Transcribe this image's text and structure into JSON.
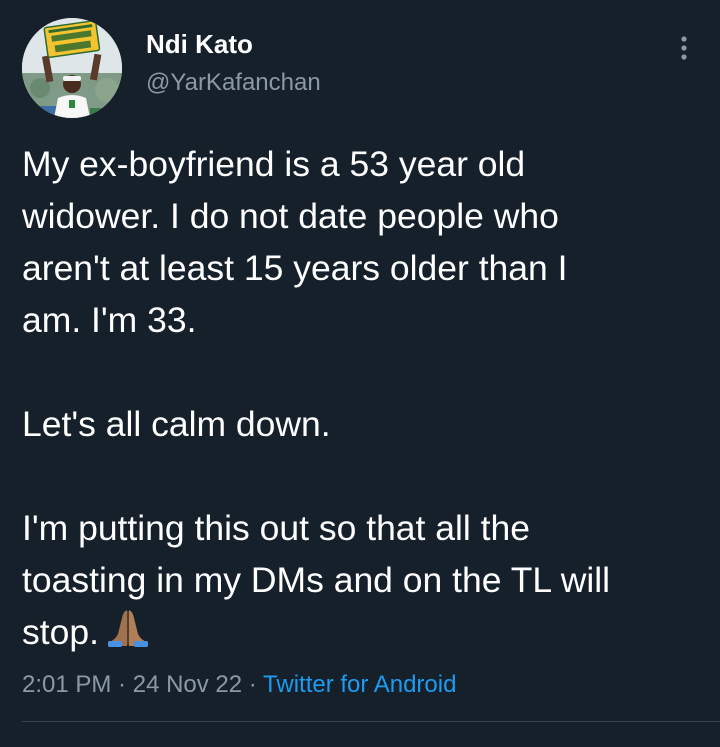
{
  "author": {
    "display_name": "Ndi Kato",
    "handle": "@YarKafanchan",
    "avatar_sign_text": "SELL MY VOTE"
  },
  "tweet": {
    "paragraphs": [
      "My ex-boyfriend is a 53 year old\nwidower. I do not date people who\naren't at least 15 years older than I\nam. I'm 33.",
      "Let's all calm down.",
      "I'm putting this out so that all the\ntoasting in my DMs and on the TL will\nstop."
    ],
    "emoji": "folded-hands"
  },
  "meta": {
    "time": "2:01 PM",
    "sep1": " · ",
    "date": "24 Nov 22",
    "sep2": " · ",
    "source": "Twitter for Android"
  },
  "colors": {
    "background": "#15202b",
    "text": "#ffffff",
    "secondary_text": "#8b98a5",
    "link": "#1d9bf0",
    "divider": "#38444d"
  },
  "icons": {
    "more": "more-vertical-icon"
  }
}
